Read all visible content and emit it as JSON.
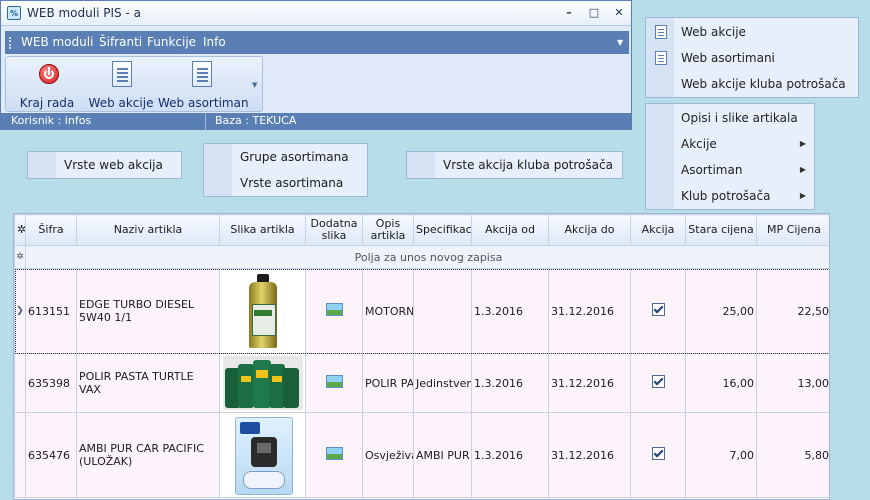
{
  "window": {
    "title": "WEB moduli PIS - a",
    "controls": [
      "–",
      "□",
      "✕"
    ]
  },
  "menu": [
    "WEB moduli",
    "Šifranti",
    "Funkcije",
    "Info"
  ],
  "ribbon": {
    "buttons": [
      {
        "label": "Kraj rada",
        "icon": "power-icon"
      },
      {
        "label": "Web akcije",
        "icon": "document-icon"
      },
      {
        "label": "Web asortiman",
        "icon": "document-icon"
      }
    ]
  },
  "status": {
    "user": "Korisnik : infos",
    "db": "Baza : TEKUCA"
  },
  "panel_web": {
    "items": [
      "Web akcije",
      "Web asortimani",
      "Web akcije kluba potrošača"
    ]
  },
  "panel_menu": {
    "items": [
      {
        "label": "Opisi i slike artikala",
        "submenu": false
      },
      {
        "label": "Akcije",
        "submenu": true
      },
      {
        "label": "Asortiman",
        "submenu": true
      },
      {
        "label": "Klub potrošača",
        "submenu": true
      }
    ]
  },
  "buttons": {
    "vrste_web_akcija": "Vrste web akcija",
    "grupe_asortimana": "Grupe asortimana",
    "vrste_asortimana": "Vrste asortimana",
    "vrste_akcija_kluba": "Vrste akcija kluba potrošača"
  },
  "grid": {
    "columns": [
      "Šifra",
      "Naziv artikla",
      "Slika artikla",
      "Dodatna slika",
      "Opis artikla",
      "Specifikacija",
      "Akcija od",
      "Akcija do",
      "Akcija",
      "Stara cijena",
      "MP Cijena"
    ],
    "new_row_text": "Polja za unos novog zapisa",
    "rows": [
      {
        "sifra": "613151",
        "naziv": "EDGE TURBO DIESEL 5W40 1/1",
        "opis": "MOTORN",
        "spec": "",
        "od": "1.3.2016",
        "do": "31.12.2016",
        "akcija": true,
        "stara": "25,00",
        "mp": "22,50"
      },
      {
        "sifra": "635398",
        "naziv": "POLIR PASTA TURTLE VAX",
        "opis": "POLIR PA",
        "spec": "Jedinstven",
        "od": "1.3.2016",
        "do": "31.12.2016",
        "akcija": true,
        "stara": "16,00",
        "mp": "13,00"
      },
      {
        "sifra": "635476",
        "naziv": "AMBI PUR CAR PACIFIC (ULOŽAK)",
        "opis": "Osvježiva",
        "spec": "AMBI PUR",
        "od": "1.3.2016",
        "do": "31.12.2016",
        "akcija": true,
        "stara": "7,00",
        "mp": "5,80"
      }
    ]
  }
}
